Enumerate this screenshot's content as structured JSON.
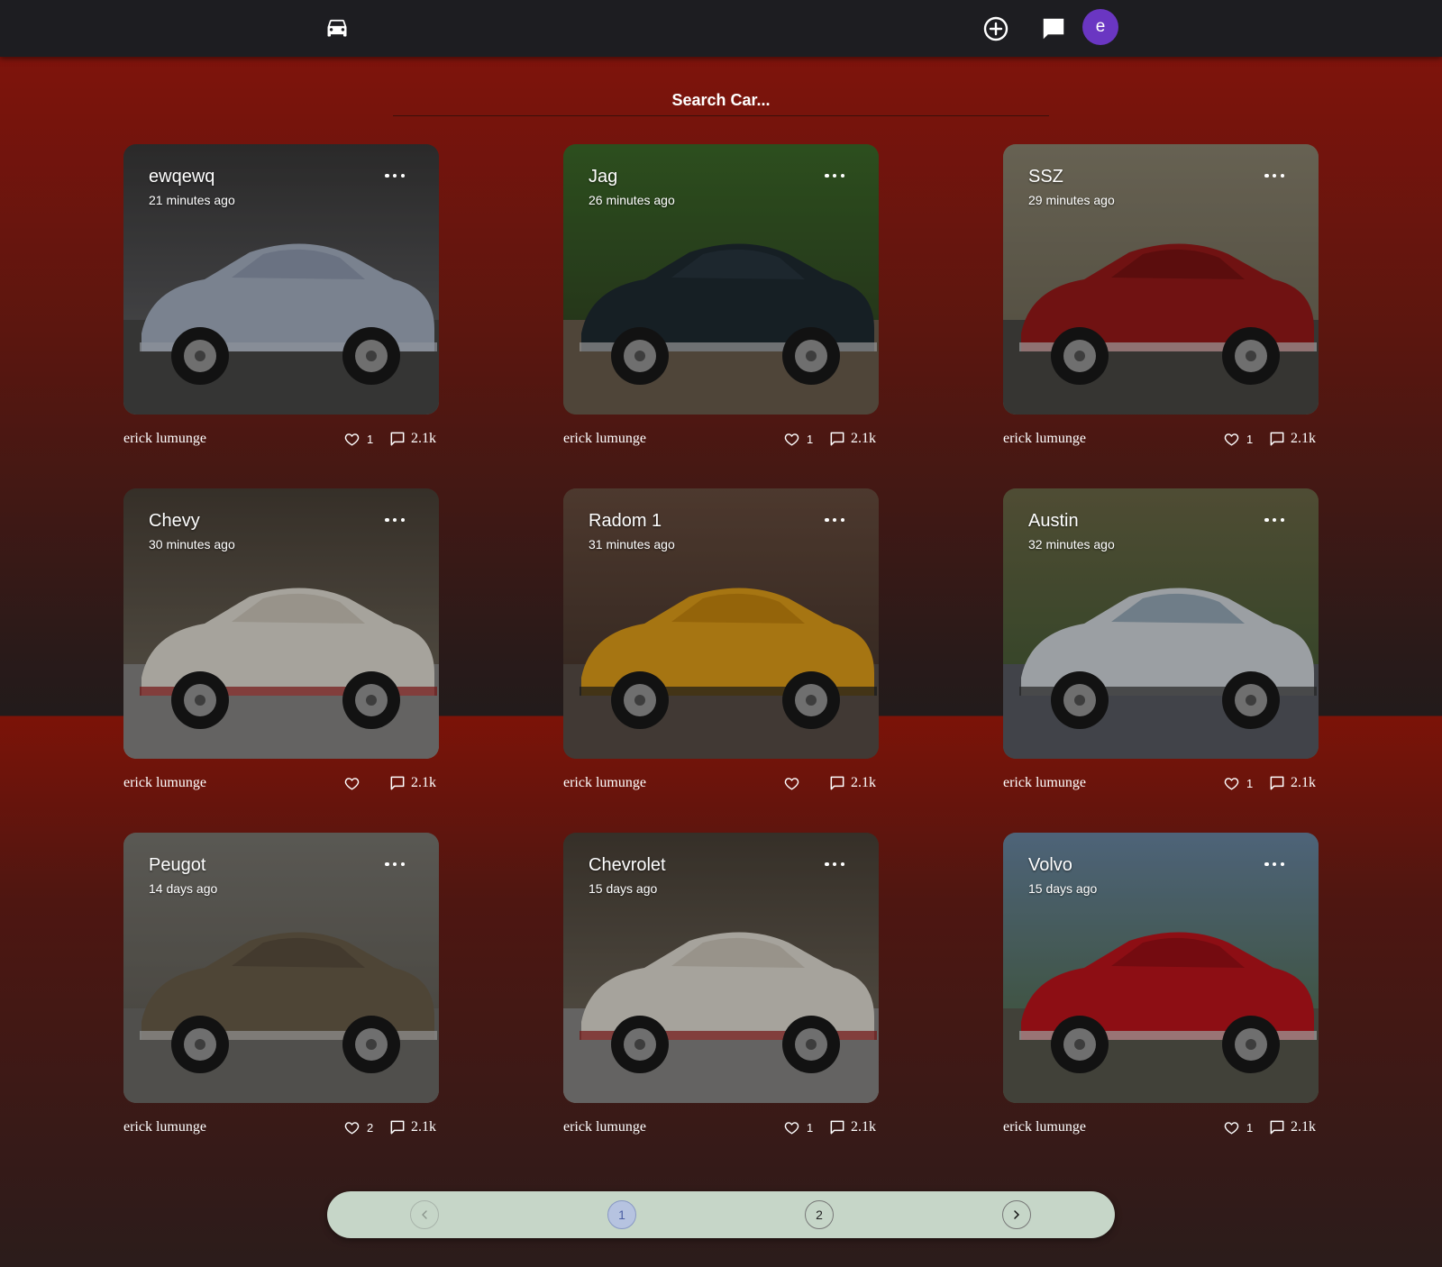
{
  "header": {
    "logo_icon": "car-icon",
    "add_icon": "plus-circle-icon",
    "chat_icon": "chat-bubble-icon",
    "avatar_letter": "e",
    "avatar_color": "#6a36c2"
  },
  "search": {
    "placeholder": "Search Car..."
  },
  "cards": [
    {
      "title": "ewqewq",
      "time": "21 minutes ago",
      "author": "erick lumunge",
      "likes": "1",
      "comments": "2.1k",
      "photo": "silver roadster in car museum"
    },
    {
      "title": "Jag",
      "time": "26 minutes ago",
      "author": "erick lumunge",
      "likes": "1",
      "comments": "2.1k",
      "photo": "dark green coupe on gravel"
    },
    {
      "title": "SSZ",
      "time": "29 minutes ago",
      "author": "erick lumunge",
      "likes": "1",
      "comments": "2.1k",
      "photo": "red vintage roadster before stone building"
    },
    {
      "title": "Chevy",
      "time": "30 minutes ago",
      "author": "erick lumunge",
      "likes": "",
      "comments": "2.1k",
      "photo": "white convertible in exhibit"
    },
    {
      "title": "Radom 1",
      "time": "31 minutes ago",
      "author": "erick lumunge",
      "likes": "",
      "comments": "2.1k",
      "photo": "orange sedan on street"
    },
    {
      "title": "Austin",
      "time": "32 minutes ago",
      "author": "erick lumunge",
      "likes": "1",
      "comments": "2.1k",
      "photo": "blue and white roadster by railings"
    },
    {
      "title": "Peugot",
      "time": "14 days ago",
      "author": "erick lumunge",
      "likes": "2",
      "comments": "2.1k",
      "photo": "brown sedan before garage"
    },
    {
      "title": "Chevrolet",
      "time": "15 days ago",
      "author": "erick lumunge",
      "likes": "1",
      "comments": "2.1k",
      "photo": "white convertible in exhibit"
    },
    {
      "title": "Volvo",
      "time": "15 days ago",
      "author": "erick lumunge",
      "likes": "1",
      "comments": "2.1k",
      "photo": "red coupe on grass"
    }
  ],
  "pagination": {
    "prev_icon": "chevron-left-icon",
    "pages": [
      "1",
      "2"
    ],
    "current": "1",
    "next_icon": "chevron-right-icon"
  }
}
